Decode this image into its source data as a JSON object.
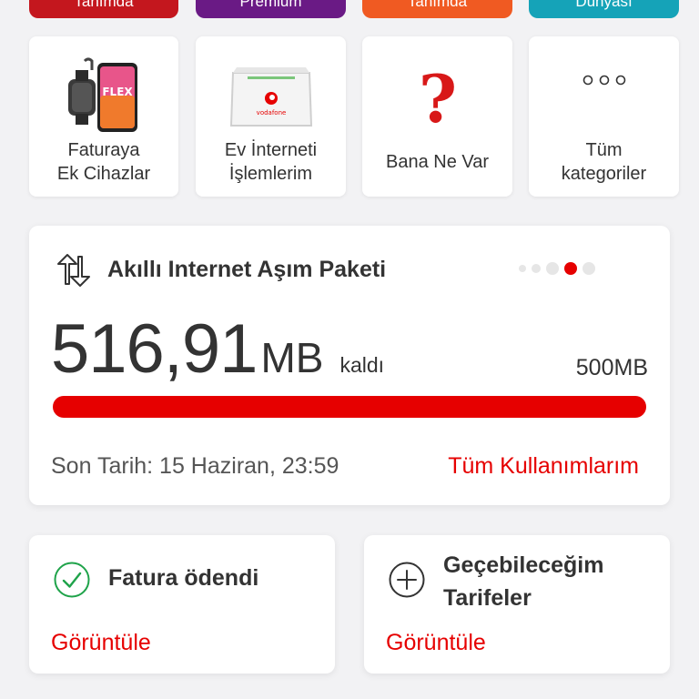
{
  "colors": {
    "accent": "#e60000",
    "card_bg": "#ffffff",
    "page_bg": "#f2f2f4"
  },
  "top_pills": [
    {
      "label": "Tanımda",
      "color": "#c4171e"
    },
    {
      "label": "Premium",
      "color": "#6a1a85"
    },
    {
      "label": "Tanımda",
      "color": "#f05a22"
    },
    {
      "label": "Dünyası",
      "color": "#15a3b8"
    }
  ],
  "categories": [
    {
      "line1": "Faturaya",
      "line2": "Ek Cihazlar",
      "icon": "phone-watch-bundle-icon"
    },
    {
      "line1": "Ev İnterneti",
      "line2": "İşlemlerim",
      "icon": "modem-icon"
    },
    {
      "line1": "Bana Ne Var",
      "line2": "",
      "icon": "question-mark-icon"
    },
    {
      "line1": "Tüm",
      "line2": "kategoriler",
      "icon": "more-dots-icon"
    }
  ],
  "package": {
    "title": "Akıllı Internet Aşım Paketi",
    "remaining_value": "516,91",
    "remaining_unit": "MB",
    "remaining_suffix": "kaldı",
    "total": "500MB",
    "progress_fraction": 1.0,
    "deadline": "Son Tarih: 15 Haziran, 23:59",
    "all_usage_link": "Tüm Kullanımlarım",
    "carousel_count": 5,
    "carousel_active": 3
  },
  "bill_card": {
    "title": "Fatura ödendi",
    "action": "Görüntüle",
    "icon": "check-circle-icon"
  },
  "tariff_card": {
    "title_line1": "Geçebileceğim",
    "title_line2": "Tarifeler",
    "action": "Görüntüle",
    "icon": "plus-circle-icon"
  }
}
